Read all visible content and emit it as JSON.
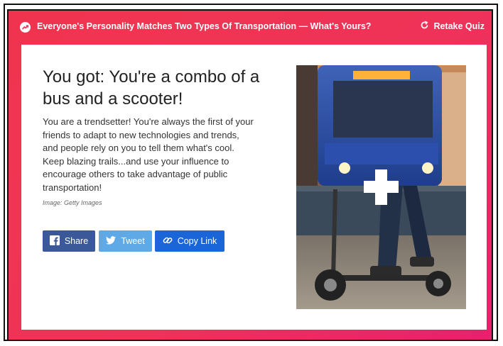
{
  "header": {
    "title": "Everyone's Personality Matches Two Types Of Transportation — What's Yours?",
    "retake_label": "Retake Quiz",
    "badge_icon": "trending-arrow-icon",
    "retake_icon": "refresh-icon"
  },
  "result": {
    "headline": "You got: You're a combo of a bus and a scooter!",
    "description": "You are a trendsetter! You're always the first of your friends to adapt to new technologies and trends, and people rely on you to tell them what's cool. Keep blazing trails...and use your influence to encourage others to take advantage of public transportation!",
    "image_credit": "Image: Getty Images"
  },
  "share": {
    "facebook_label": "Share",
    "twitter_label": "Tweet",
    "copy_link_label": "Copy Link"
  },
  "colors": {
    "accent_start": "#f0344f",
    "accent_end": "#e8206e",
    "facebook": "#3b5998",
    "twitter": "#5ea9e6",
    "copy_link": "#1a66d8"
  }
}
